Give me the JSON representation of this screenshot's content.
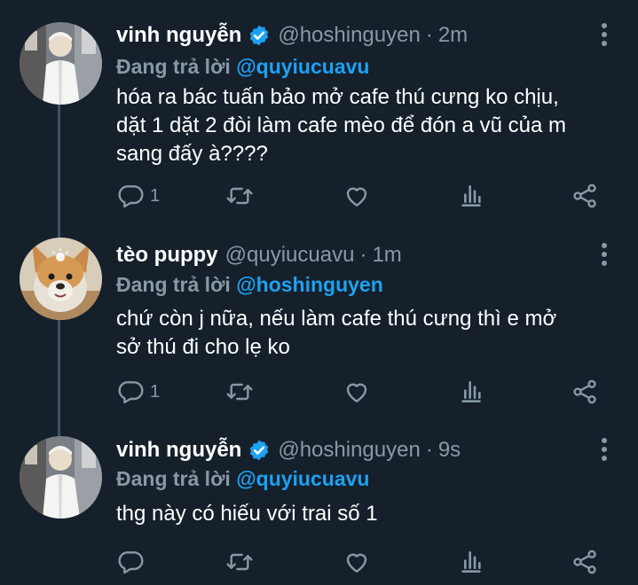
{
  "tweets": [
    {
      "name": "vinh nguyễn",
      "verified": true,
      "handle": "@hoshinguyen",
      "time": "2m",
      "reply_prefix": "Đang trả lời",
      "reply_to": "@quyiucuavu",
      "lines": [
        "hóa ra bác tuấn bảo mở cafe thú cưng ko chịu,",
        "dặt 1 dặt 2 đòi làm cafe mèo để đón a vũ của m",
        "sang đấy à????"
      ],
      "reply_count": "1"
    },
    {
      "name": "tèo puppy",
      "verified": false,
      "handle": "@quyiucuavu",
      "time": "1m",
      "reply_prefix": "Đang trả lời",
      "reply_to": "@hoshinguyen",
      "lines": [
        "chứ còn j nữa, nếu làm cafe thú cưng thì e mở",
        "sở thú đi cho lẹ ko"
      ],
      "reply_count": "1"
    },
    {
      "name": "vinh nguyễn",
      "verified": true,
      "handle": "@hoshinguyen",
      "time": "9s",
      "reply_prefix": "Đang trả lời",
      "reply_to": "@quyiucuavu",
      "lines": [
        "thg này có hiếu với trai số 1"
      ],
      "reply_count": ""
    }
  ],
  "separator": "·",
  "colors": {
    "background": "#15202b",
    "text": "#ffffff",
    "secondary": "#8899a6",
    "accent": "#1da1f2",
    "thread_line": "#3d5466"
  },
  "icons": [
    "verified-badge-icon",
    "more-options-icon",
    "reply-icon",
    "retweet-icon",
    "like-icon",
    "analytics-icon",
    "share-icon"
  ]
}
